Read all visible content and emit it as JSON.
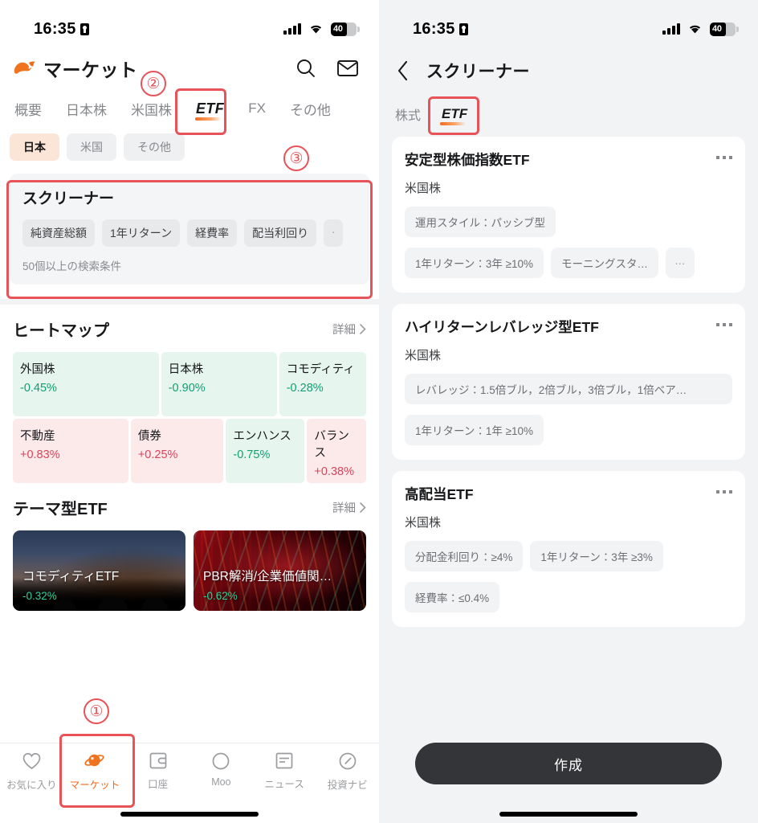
{
  "status_bar": {
    "time": "16:35",
    "battery_percent": "40",
    "icons": [
      "lock-portrait-icon",
      "cellular-signal-icon",
      "wifi-icon",
      "battery-icon"
    ]
  },
  "left": {
    "app_title": "マーケット",
    "logo_icon": "moomoo-bull-logo",
    "header_icons": [
      {
        "name": "search-icon"
      },
      {
        "name": "mail-icon"
      }
    ],
    "tabs": [
      {
        "label": "概要",
        "active": false
      },
      {
        "label": "日本株",
        "active": false
      },
      {
        "label": "米国株",
        "active": false
      },
      {
        "label": "ETF",
        "active": true
      },
      {
        "label": "FX",
        "active": false
      },
      {
        "label": "その他",
        "active": false
      }
    ],
    "region_chips": [
      {
        "label": "日本",
        "active": true
      },
      {
        "label": "米国",
        "active": false
      },
      {
        "label": "その他",
        "active": false
      }
    ],
    "screener": {
      "title": "スクリーナー",
      "chips": [
        "純資産総額",
        "1年リターン",
        "経費率",
        "配当利回り"
      ],
      "more_chip": "·",
      "subtitle": "50個以上の検索条件"
    },
    "heatmap": {
      "title": "ヒートマップ",
      "more_label": "詳細",
      "tiles_row1": [
        {
          "name": "外国株",
          "value": "-0.45%",
          "dir": "down"
        },
        {
          "name": "日本株",
          "value": "-0.90%",
          "dir": "down"
        },
        {
          "name": "コモディティ",
          "value": "-0.28%",
          "dir": "down"
        }
      ],
      "tiles_row2": [
        {
          "name": "不動産",
          "value": "+0.83%",
          "dir": "up"
        },
        {
          "name": "債券",
          "value": "+0.25%",
          "dir": "up"
        },
        {
          "name": "エンハンス",
          "value": "-0.75%",
          "dir": "down"
        },
        {
          "name": "バランス",
          "value": "+0.38%",
          "dir": "up"
        }
      ]
    },
    "theme_etf": {
      "title": "テーマ型ETF",
      "more_label": "詳細",
      "cards": [
        {
          "name": "コモディティETF",
          "value": "-0.32%",
          "image": "oil-pumpjack-photo"
        },
        {
          "name": "PBR解消/企業価値関…",
          "value": "-0.62%",
          "image": "stock-chart-photo"
        }
      ]
    },
    "tabbar": [
      {
        "label": "お気に入り",
        "icon": "heart-icon",
        "active": false
      },
      {
        "label": "マーケット",
        "icon": "planet-icon",
        "active": true
      },
      {
        "label": "口座",
        "icon": "wallet-icon",
        "active": false
      },
      {
        "label": "Moo",
        "icon": "moo-icon",
        "active": false
      },
      {
        "label": "ニュース",
        "icon": "news-icon",
        "active": false
      },
      {
        "label": "投資ナビ",
        "icon": "compass-icon",
        "active": false
      }
    ]
  },
  "right": {
    "back_icon": "chevron-left-icon",
    "title": "スクリーナー",
    "tabs": [
      {
        "label": "株式",
        "active": false
      },
      {
        "label": "ETF",
        "active": true
      }
    ],
    "cards": [
      {
        "name": "安定型株価指数ETF",
        "market": "米国株",
        "menu_icon": "more-options-icon",
        "tag_rows": [
          [
            {
              "text": "運用スタイル：パッシブ型",
              "type": "tag"
            }
          ],
          [
            {
              "text": "1年リターン：3年 ≥10%",
              "type": "tag"
            },
            {
              "text": "モーニングスタ…",
              "type": "tag"
            },
            {
              "text": "…",
              "type": "more"
            }
          ]
        ]
      },
      {
        "name": "ハイリターンレバレッジ型ETF",
        "market": "米国株",
        "menu_icon": "more-options-icon",
        "tag_rows": [
          [
            {
              "text": "レバレッジ：1.5倍ブル，2倍ブル，3倍ブル，1倍ベア…",
              "type": "wide"
            }
          ],
          [
            {
              "text": "1年リターン：1年 ≥10%",
              "type": "tag"
            }
          ]
        ]
      },
      {
        "name": "高配当ETF",
        "market": "米国株",
        "menu_icon": "more-options-icon",
        "tag_rows": [
          [
            {
              "text": "分配金利回り：≥4%",
              "type": "tag"
            },
            {
              "text": "1年リターン：3年 ≥3%",
              "type": "tag"
            }
          ],
          [
            {
              "text": "経費率：≤0.4%",
              "type": "tag"
            }
          ]
        ]
      }
    ],
    "create_button": "作成"
  },
  "annotations": [
    {
      "label": "①",
      "target": "market-tab-callout"
    },
    {
      "label": "②",
      "target": "etf-tab-callout"
    },
    {
      "label": "③",
      "target": "screener-card-callout"
    }
  ],
  "colors": {
    "accent": "#f06a1e",
    "annotation": "#e8535a",
    "up": "#d9455b",
    "down": "#0fa071",
    "panel_bg": "#f2f3f5"
  }
}
